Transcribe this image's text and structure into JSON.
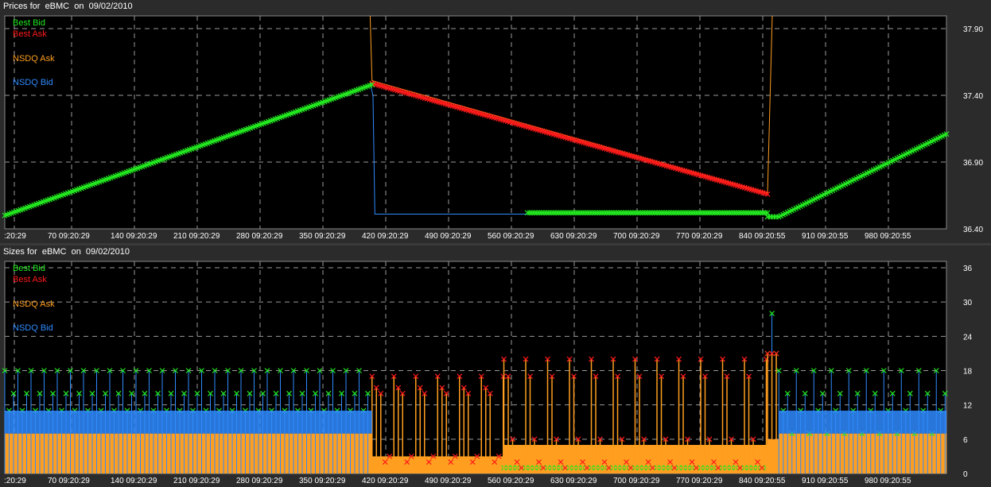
{
  "prices_panel": {
    "title": "Prices for  eBMC  on  09/02/2010",
    "chart_data": {
      "type": "line",
      "title": "Prices for  eBMC  on  09/02/2010",
      "legend": [
        "Best Bid",
        "Best Ask",
        "NSDQ Ask",
        "NSDQ Bid"
      ],
      "legend_position": "top-left",
      "ylim": [
        36.4,
        37.9
      ],
      "y_ticks": [
        "37.90",
        "37.40",
        "36.90",
        "36.40"
      ],
      "x_ticks": [
        ":20:29",
        "70 09:20:29",
        "140 09:20:29",
        "210 09:20:29",
        "280 09:20:29",
        "350 09:20:29",
        "420 09:20:29",
        "490 09:20:29",
        "560 09:20:29",
        "630 09:20:29",
        "700 09:20:29",
        "770 09:20:29",
        "840 09:20:55",
        "910 09:20:55",
        "980 09:20:55"
      ],
      "grid": true,
      "colors": {
        "best_bid": "#22e81f",
        "best_ask": "#ff1a1a",
        "nsdq_ask": "#ff9e1f",
        "nsdq_bid": "#2f8bff"
      },
      "series": [
        {
          "name": "Best Bid",
          "points": [
            [
              0,
              36.5
            ],
            [
              390,
              37.48
            ]
          ],
          "points2": [
            [
              555,
              36.52
            ],
            [
              810,
              36.52
            ]
          ],
          "points3": [
            [
              810,
              36.49
            ],
            [
              822,
              36.49
            ],
            [
              1000,
              37.11
            ]
          ]
        },
        {
          "name": "Best Ask",
          "points": [
            [
              390,
              37.49
            ],
            [
              810,
              36.66
            ]
          ]
        },
        {
          "name": "NSDQ Ask",
          "points": [
            [
              388,
              38.5
            ],
            [
              390,
              37.51
            ],
            [
              810,
              36.67
            ],
            [
              815,
              38.5
            ]
          ]
        },
        {
          "name": "NSDQ Bid",
          "points": [
            [
              388,
              37.49
            ],
            [
              391,
              37.4
            ],
            [
              393,
              36.51
            ],
            [
              555,
              36.51
            ]
          ]
        }
      ]
    }
  },
  "sizes_panel": {
    "title": "Sizes for  eBMC  on  09/02/2010",
    "chart_data": {
      "type": "bar",
      "title": "Sizes for  eBMC  on  09/02/2010",
      "legend": [
        "Best Bid",
        "Best Ask",
        "NSDQ Ask",
        "NSDQ Bid"
      ],
      "legend_position": "top-left",
      "ylim": [
        0,
        36
      ],
      "y_ticks": [
        "36",
        "30",
        "24",
        "18",
        "12",
        "6",
        "0"
      ],
      "x_ticks": [
        ":20:29",
        "70 09:20:29",
        "140 09:20:29",
        "210 09:20:29",
        "280 09:20:29",
        "350 09:20:29",
        "420 09:20:29",
        "490 09:20:29",
        "560 09:20:29",
        "630 09:20:29",
        "700 09:20:29",
        "770 09:20:29",
        "840 09:20:55",
        "910 09:20:55",
        "980 09:20:55"
      ],
      "grid": true,
      "colors": {
        "best_bid": "#22e81f",
        "best_ask": "#ff1a1a",
        "nsdq_ask": "#ff9e1f",
        "nsdq_bid": "#2f8bff"
      },
      "segments": [
        {
          "from": 0,
          "to": 390,
          "nsdq_ask": 7,
          "bid_levels": [
            18,
            11,
            14
          ],
          "ask_levels": []
        },
        {
          "from": 390,
          "to": 530,
          "nsdq_ask": 3,
          "bid_levels": [],
          "ask_levels": [
            17,
            15,
            14,
            2,
            3
          ]
        },
        {
          "from": 530,
          "to": 810,
          "nsdq_ask": 5,
          "bid_levels": [
            1
          ],
          "ask_levels": [
            20,
            17,
            6,
            2,
            1
          ]
        },
        {
          "from": 810,
          "to": 822,
          "nsdq_ask": 6,
          "bid_levels": [
            21,
            28
          ],
          "ask_levels": [
            21
          ]
        },
        {
          "from": 822,
          "to": 1000,
          "nsdq_ask": 7,
          "bid_levels": [
            18,
            11,
            14,
            7
          ],
          "ask_levels": []
        }
      ],
      "x_range": [
        0,
        1000
      ]
    }
  }
}
